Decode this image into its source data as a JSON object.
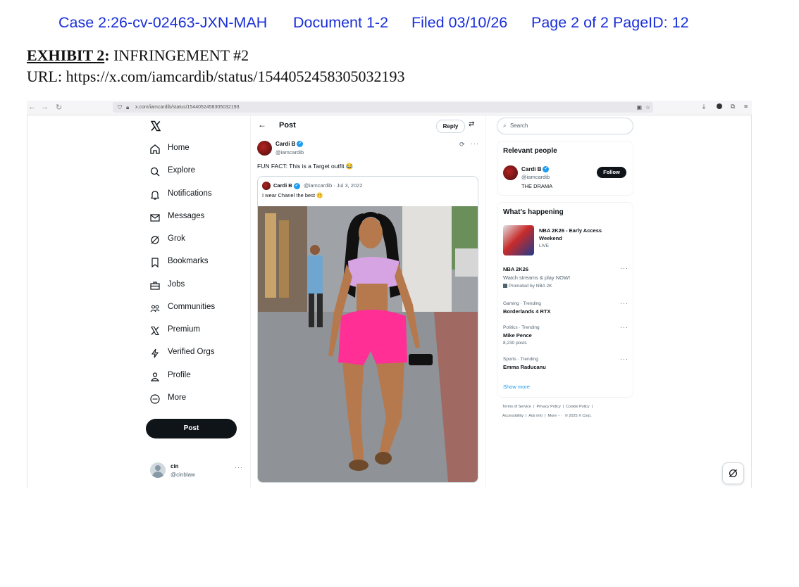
{
  "court_header": {
    "case": "Case 2:26-cv-02463-JXN-MAH",
    "document": "Document 1-2",
    "filed": "Filed 03/10/26",
    "page": "Page 2 of 2 PageID: 12"
  },
  "exhibit": {
    "label": "EXHIBIT 2",
    "colon": ":",
    "title": " INFRINGEMENT #2",
    "url_line": "URL: https://x.com/iamcardib/status/1544052458305032193"
  },
  "browser": {
    "url": "x.com/iamcardib/status/1544052458305032193"
  },
  "nav": {
    "items": [
      {
        "label": "Home",
        "icon": "home-icon"
      },
      {
        "label": "Explore",
        "icon": "search-icon"
      },
      {
        "label": "Notifications",
        "icon": "bell-icon"
      },
      {
        "label": "Messages",
        "icon": "envelope-icon"
      },
      {
        "label": "Grok",
        "icon": "grok-icon"
      },
      {
        "label": "Bookmarks",
        "icon": "bookmark-icon"
      },
      {
        "label": "Jobs",
        "icon": "briefcase-icon"
      },
      {
        "label": "Communities",
        "icon": "people-icon"
      },
      {
        "label": "Premium",
        "icon": "x-logo-icon"
      },
      {
        "label": "Verified Orgs",
        "icon": "lightning-icon"
      },
      {
        "label": "Profile",
        "icon": "person-icon"
      },
      {
        "label": "More",
        "icon": "more-circle-icon"
      }
    ],
    "post_button": "Post",
    "account": {
      "name": "cin",
      "handle": "@cinblaw"
    }
  },
  "post": {
    "header_title": "Post",
    "reply_button": "Reply",
    "author_name": "Cardi B",
    "author_handle": "@iamcardib",
    "text": "FUN FACT: This is a Target outfit 😂",
    "quote": {
      "author_name": "Cardi B",
      "handle_date": "@iamcardib · Jul 3, 2022",
      "text": "I wear Chanel the best 🤫"
    }
  },
  "sidebar": {
    "search_placeholder": "Search",
    "relevant": {
      "title": "Relevant people",
      "name": "Cardi B",
      "handle": "@iamcardib",
      "bio": "THE DRAMA",
      "follow_button": "Follow"
    },
    "happening": {
      "title": "What’s happening",
      "featured": {
        "title": "NBA 2K26 - Early Access Weekend",
        "status": "LIVE"
      },
      "promoted": {
        "title": "NBA 2K26",
        "desc": "Watch streams & play NOW!",
        "promoted_by": "Promoted by NBA 2K"
      },
      "trends": [
        {
          "context": "Gaming · Trending",
          "title": "Borderlands 4 RTX",
          "count": ""
        },
        {
          "context": "Politics · Trending",
          "title": "Mike Pence",
          "count": "8,230 posts"
        },
        {
          "context": "Sports · Trending",
          "title": "Emma Raducanu",
          "count": ""
        }
      ],
      "show_more": "Show more"
    },
    "footer": {
      "row1": [
        "Terms of Service",
        "Privacy Policy",
        "Cookie Policy"
      ],
      "row2": [
        "Accessibility",
        "Ads info",
        "More ···",
        "© 2025 X Corp."
      ]
    }
  },
  "colors": {
    "court_blue": "#1a2fd9",
    "x_black": "#0f1419",
    "verified_blue": "#1d9bf0",
    "muted": "#536471",
    "link_blue": "#1d9bf0"
  }
}
